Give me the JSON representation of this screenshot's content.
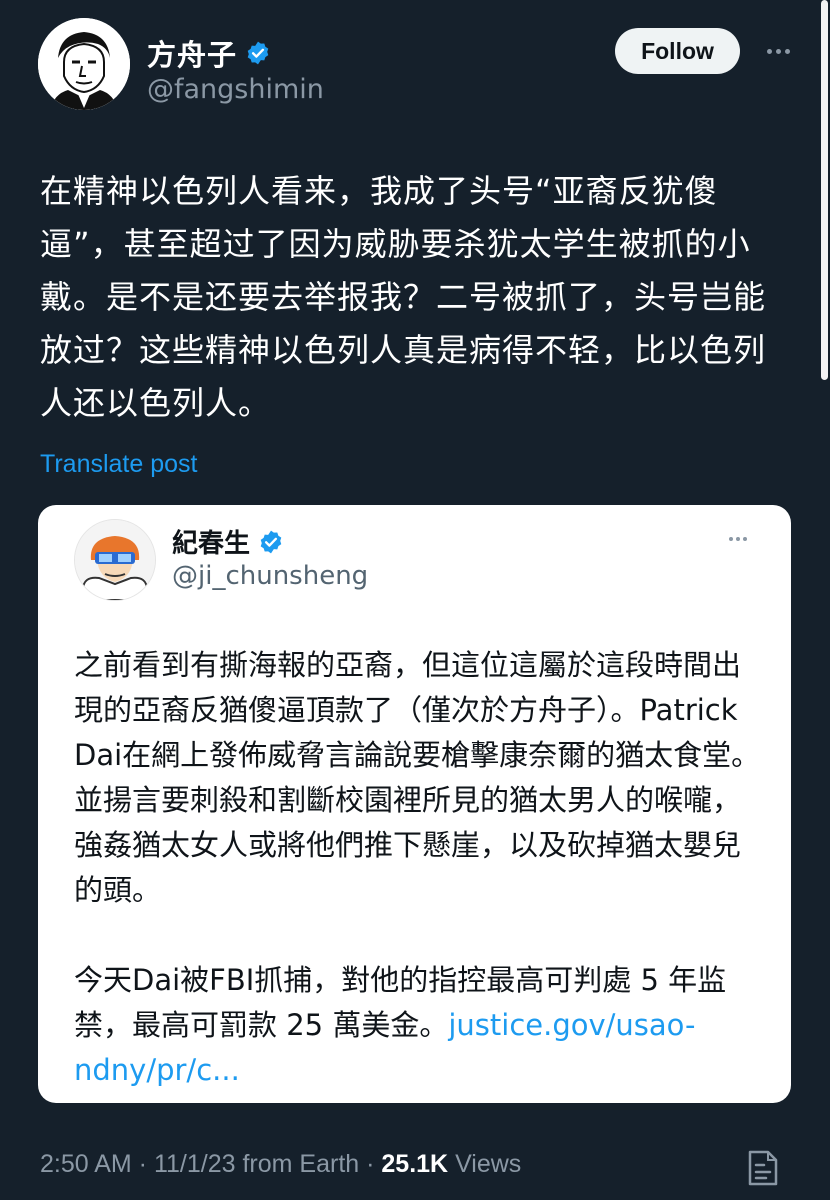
{
  "author": {
    "display_name": "方舟子",
    "handle": "@fangshimin"
  },
  "follow_label": "Follow",
  "tweet": {
    "text": "在精神以色列人看来，我成了头号“亚裔反犹傻逼”，甚至超过了因为威胁要杀犹太学生被抓的小戴。是不是还要去举报我？二号被抓了，头号岂能放过？这些精神以色列人真是病得不轻，比以色列人还以色列人。",
    "translate_label": "Translate post"
  },
  "quote": {
    "display_name": "紀春生",
    "handle": "@ji_chunsheng",
    "paragraph1": "之前看到有撕海報的亞裔，但這位這屬於這段時間出現的亞裔反猶傻逼頂款了（僅次於方舟子）。Patrick Dai在網上發佈威脅言論說要槍擊康奈爾的猶太食堂。並揚言要刺殺和割斷校園裡所見的猶太男人的喉嚨，強姦猶太女人或將他們推下懸崖，以及砍掉猶太嬰兒的頭。",
    "paragraph2": "今天Dai被FBI抓捕，對他的指控最高可判處 5 年监禁，最高可罰款 25 萬美金。",
    "link_text": "justice.gov/usao-ndny/pr/c..."
  },
  "meta": {
    "time": "2:50 AM",
    "date": "11/1/23",
    "source": "from Earth",
    "views_count": "25.1K",
    "views_label": "Views"
  },
  "colors": {
    "background": "#15202b",
    "accent": "#1d9bf0",
    "secondary_text": "#8b98a5",
    "card": "#ffffff"
  },
  "icons": [
    "verified-badge-icon",
    "more-options-icon",
    "analytics-icon"
  ]
}
